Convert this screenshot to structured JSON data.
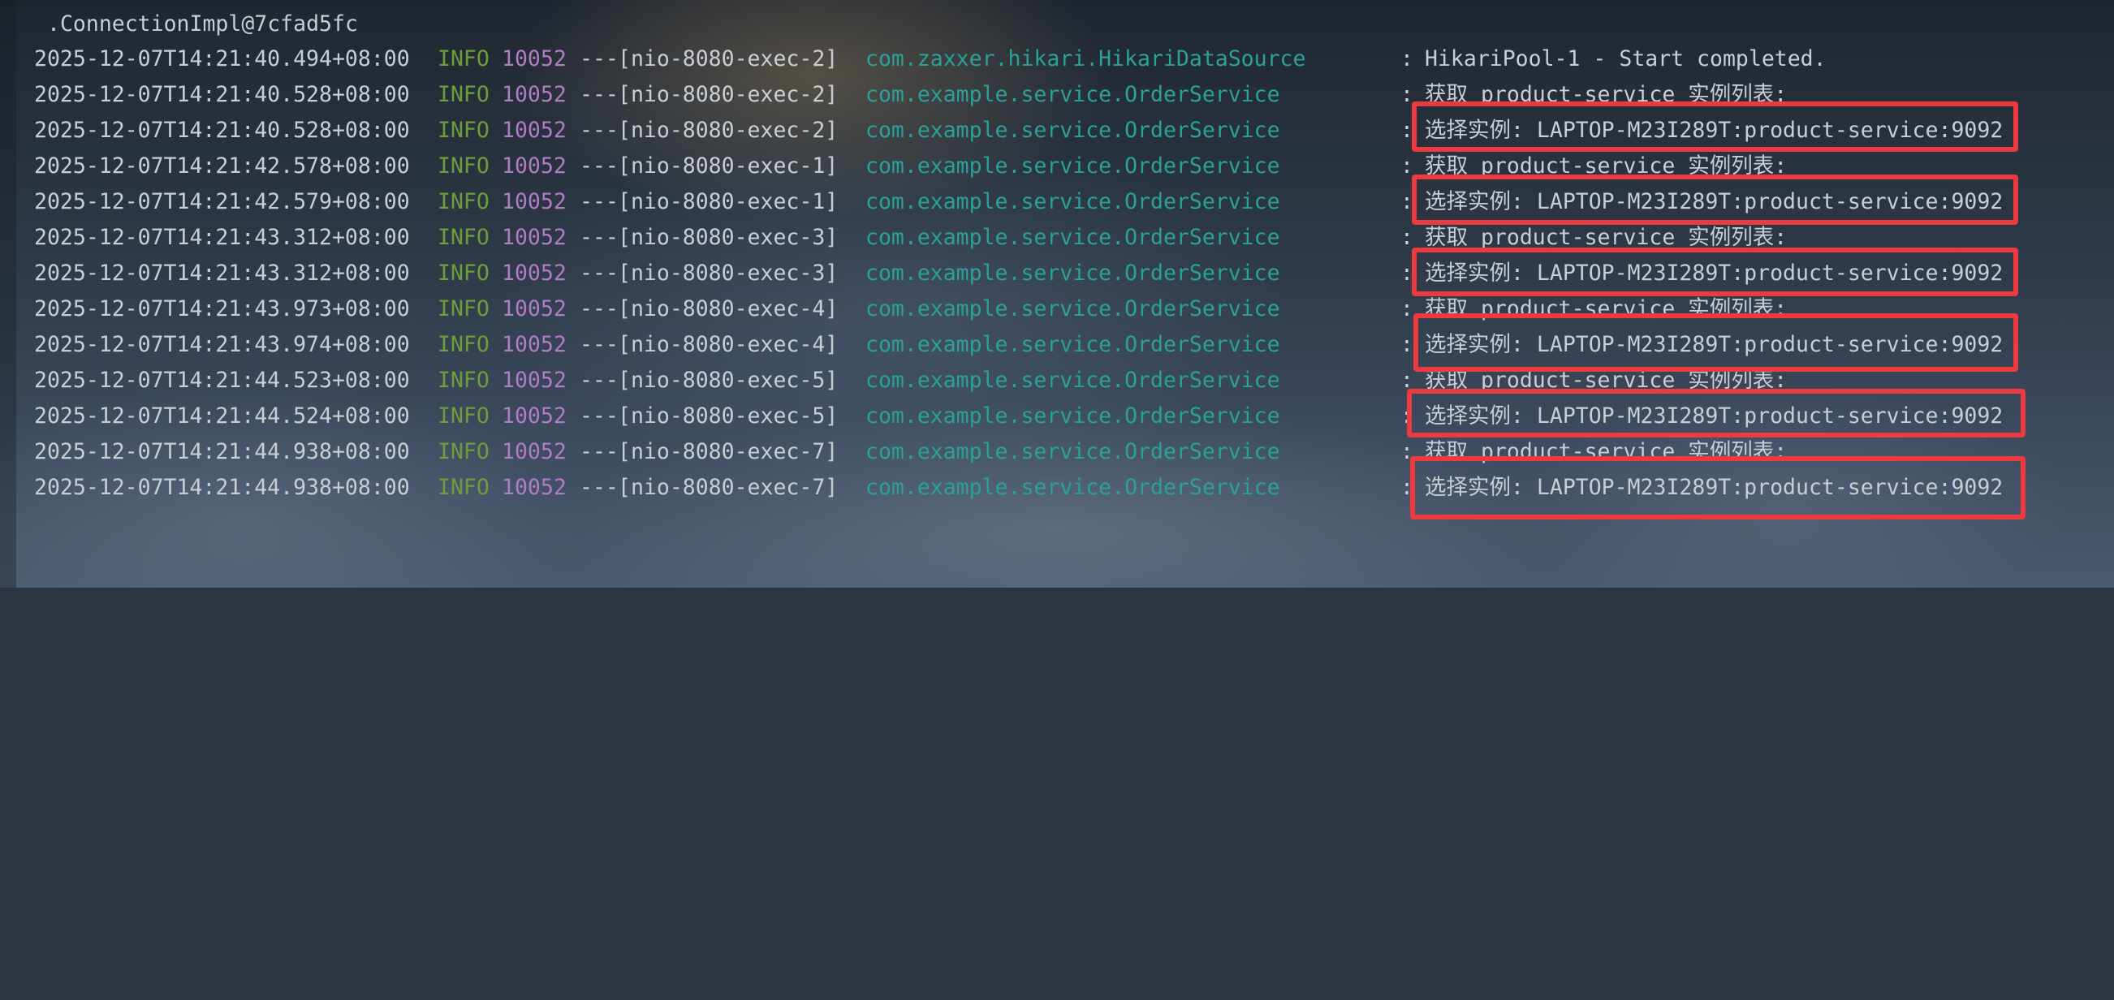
{
  "console": {
    "header": ".ConnectionImpl@7cfad5fc",
    "lines": [
      {
        "timestamp": "2025-12-07T14:21:40.494+08:00",
        "level": "INFO",
        "pid": "10052",
        "sep": "---",
        "thread": "[nio-8080-exec-2]",
        "logger": "com.zaxxer.hikari.HikariDataSource",
        "colon": ":",
        "message": "HikariPool-1 - Start completed."
      },
      {
        "timestamp": "2025-12-07T14:21:40.528+08:00",
        "level": "INFO",
        "pid": "10052",
        "sep": "---",
        "thread": "[nio-8080-exec-2]",
        "logger": "com.example.service.OrderService",
        "colon": ":",
        "message": "获取 product-service 实例列表:"
      },
      {
        "timestamp": "2025-12-07T14:21:40.528+08:00",
        "level": "INFO",
        "pid": "10052",
        "sep": "---",
        "thread": "[nio-8080-exec-2]",
        "logger": "com.example.service.OrderService",
        "colon": ":",
        "message": "选择实例: LAPTOP-M23I289T:product-service:9092"
      },
      {
        "timestamp": "2025-12-07T14:21:42.578+08:00",
        "level": "INFO",
        "pid": "10052",
        "sep": "---",
        "thread": "[nio-8080-exec-1]",
        "logger": "com.example.service.OrderService",
        "colon": ":",
        "message": "获取 product-service 实例列表:"
      },
      {
        "timestamp": "2025-12-07T14:21:42.579+08:00",
        "level": "INFO",
        "pid": "10052",
        "sep": "---",
        "thread": "[nio-8080-exec-1]",
        "logger": "com.example.service.OrderService",
        "colon": ":",
        "message": "选择实例: LAPTOP-M23I289T:product-service:9092"
      },
      {
        "timestamp": "2025-12-07T14:21:43.312+08:00",
        "level": "INFO",
        "pid": "10052",
        "sep": "---",
        "thread": "[nio-8080-exec-3]",
        "logger": "com.example.service.OrderService",
        "colon": ":",
        "message": "获取 product-service 实例列表:"
      },
      {
        "timestamp": "2025-12-07T14:21:43.312+08:00",
        "level": "INFO",
        "pid": "10052",
        "sep": "---",
        "thread": "[nio-8080-exec-3]",
        "logger": "com.example.service.OrderService",
        "colon": ":",
        "message": "选择实例: LAPTOP-M23I289T:product-service:9092"
      },
      {
        "timestamp": "2025-12-07T14:21:43.973+08:00",
        "level": "INFO",
        "pid": "10052",
        "sep": "---",
        "thread": "[nio-8080-exec-4]",
        "logger": "com.example.service.OrderService",
        "colon": ":",
        "message": "获取 product-service 实例列表:"
      },
      {
        "timestamp": "2025-12-07T14:21:43.974+08:00",
        "level": "INFO",
        "pid": "10052",
        "sep": "---",
        "thread": "[nio-8080-exec-4]",
        "logger": "com.example.service.OrderService",
        "colon": ":",
        "message": "选择实例: LAPTOP-M23I289T:product-service:9092"
      },
      {
        "timestamp": "2025-12-07T14:21:44.523+08:00",
        "level": "INFO",
        "pid": "10052",
        "sep": "---",
        "thread": "[nio-8080-exec-5]",
        "logger": "com.example.service.OrderService",
        "colon": ":",
        "message": "获取 product-service 实例列表:"
      },
      {
        "timestamp": "2025-12-07T14:21:44.524+08:00",
        "level": "INFO",
        "pid": "10052",
        "sep": "---",
        "thread": "[nio-8080-exec-5]",
        "logger": "com.example.service.OrderService",
        "colon": ":",
        "message": "选择实例: LAPTOP-M23I289T:product-service:9092"
      },
      {
        "timestamp": "2025-12-07T14:21:44.938+08:00",
        "level": "INFO",
        "pid": "10052",
        "sep": "---",
        "thread": "[nio-8080-exec-7]",
        "logger": "com.example.service.OrderService",
        "colon": ":",
        "message": "获取 product-service 实例列表:"
      },
      {
        "timestamp": "2025-12-07T14:21:44.938+08:00",
        "level": "INFO",
        "pid": "10052",
        "sep": "---",
        "thread": "[nio-8080-exec-7]",
        "logger": "com.example.service.OrderService",
        "colon": ":",
        "message": "选择实例: LAPTOP-M23I289T:product-service:9092"
      }
    ]
  },
  "colors": {
    "level_info": "#6e9e3a",
    "pid": "#b07cc6",
    "logger": "#2aa198",
    "text": "#c9ced6",
    "highlight_box": "#ec3a3f"
  }
}
